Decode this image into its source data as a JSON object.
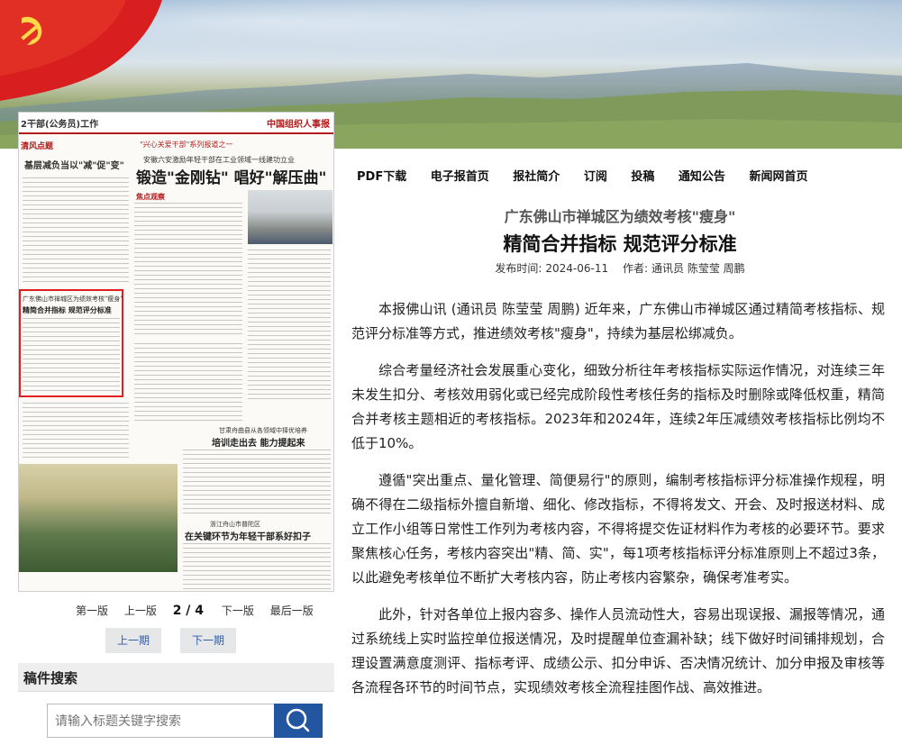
{
  "banner": {
    "flag_icon": "party-flag-icon"
  },
  "newspaper": {
    "section": "2干部(公务员)工作",
    "logo": "中国组织人事报",
    "column_left": "清风点题",
    "left_headline": "基层减负当以\"减\"促\"变\"",
    "series": "\"兴心关爱干部\"系列报道之一",
    "kicker": "安徽六安激励年轻干部在工业领域一线建功立业",
    "headline": "锻造\"金刚钻\" 唱好\"解压曲\"",
    "focus_tag": "焦点观察",
    "highlight_line1": "广东佛山市禅城区为绩效考核\"瘦身\"",
    "highlight_line2": "精简合并指标 规范评分标准",
    "mid_kicker": "甘肃舟曲县从各领域中择优培养",
    "mid_headline": "培训走出去 能力提起来",
    "lower_kicker": "浙江舟山市普陀区",
    "lower_headline": "在关键环节为年轻干部系好扣子"
  },
  "pager": {
    "first": "第一版",
    "prev": "上一版",
    "current": "2 / 4",
    "next": "下一版",
    "last": "最后一版"
  },
  "issue_buttons": {
    "prev": "上一期",
    "next": "下一期"
  },
  "search": {
    "heading": "稿件搜索",
    "placeholder": "请输入标题关键字搜索",
    "button_icon": "search-icon"
  },
  "nav": [
    "PDF下载",
    "电子报首页",
    "报社简介",
    "订阅",
    "投稿",
    "通知公告",
    "新闻网首页"
  ],
  "article": {
    "subtitle": "广东佛山市禅城区为绩效考核\"瘦身\"",
    "title": "精简合并指标 规范评分标准",
    "date_label": "发布时间:",
    "date": "2024-06-11",
    "author_label": "作者:",
    "author": "通讯员 陈莹莹 周鹏",
    "paragraphs": [
      "本报佛山讯 (通讯员 陈莹莹 周鹏) 近年来，广东佛山市禅城区通过精简考核指标、规范评分标准等方式，推进绩效考核\"瘦身\"，持续为基层松绑减负。",
      "综合考量经济社会发展重心变化，细致分析往年考核指标实际运作情况，对连续三年未发生扣分、考核效用弱化或已经完成阶段性考核任务的指标及时删除或降低权重，精简合并考核主题相近的考核指标。2023年和2024年，连续2年压减绩效考核指标比例均不低于10%。",
      "遵循\"突出重点、量化管理、简便易行\"的原则，编制考核指标评分标准操作规程，明确不得在二级指标外擅自新增、细化、修改指标，不得将发文、开会、及时报送材料、成立工作小组等日常性工作列为考核内容，不得将提交佐证材料作为考核的必要环节。要求聚焦核心任务，考核内容突出\"精、简、实\"，每1项考核指标评分标准原则上不超过3条，以此避免考核单位不断扩大考核内容，防止考核内容繁杂，确保考准考实。",
      "此外，针对各单位上报内容多、操作人员流动性大，容易出现误报、漏报等情况，通过系统线上实时监控单位报送情况，及时提醒单位查漏补缺；线下做好时间铺排规划，合理设置满意度测评、指标考评、成绩公示、扣分申诉、否决情况统计、加分申报及审核等各流程各环节的时间节点，实现绩效考核全流程挂图作战、高效推进。"
    ]
  }
}
